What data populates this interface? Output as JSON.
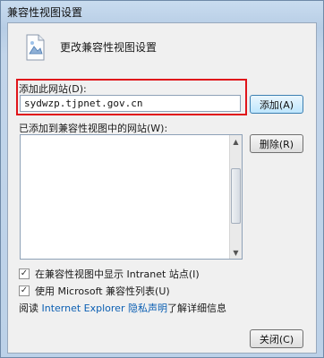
{
  "window": {
    "title": "兼容性视图设置"
  },
  "header": {
    "label": "更改兼容性视图设置"
  },
  "add": {
    "label": "添加此网站(D):",
    "value": "sydwzp.tjpnet.gov.cn",
    "button_label": "添加(A)"
  },
  "list": {
    "label": "已添加到兼容性视图中的网站(W):",
    "items": [],
    "remove_label": "删除(R)"
  },
  "options": [
    {
      "label": "在兼容性视图中显示 Intranet 站点(I)",
      "checked": true
    },
    {
      "label": "使用 Microsoft 兼容性列表(U)",
      "checked": true
    }
  ],
  "info": {
    "prefix": "阅读",
    "link1": "Internet Explorer",
    "link2": "隐私声明",
    "suffix": "了解详细信息"
  },
  "footer": {
    "close_label": "关闭(C)"
  },
  "colors": {
    "highlight": "#e0141a",
    "link": "#0b5fb3"
  }
}
